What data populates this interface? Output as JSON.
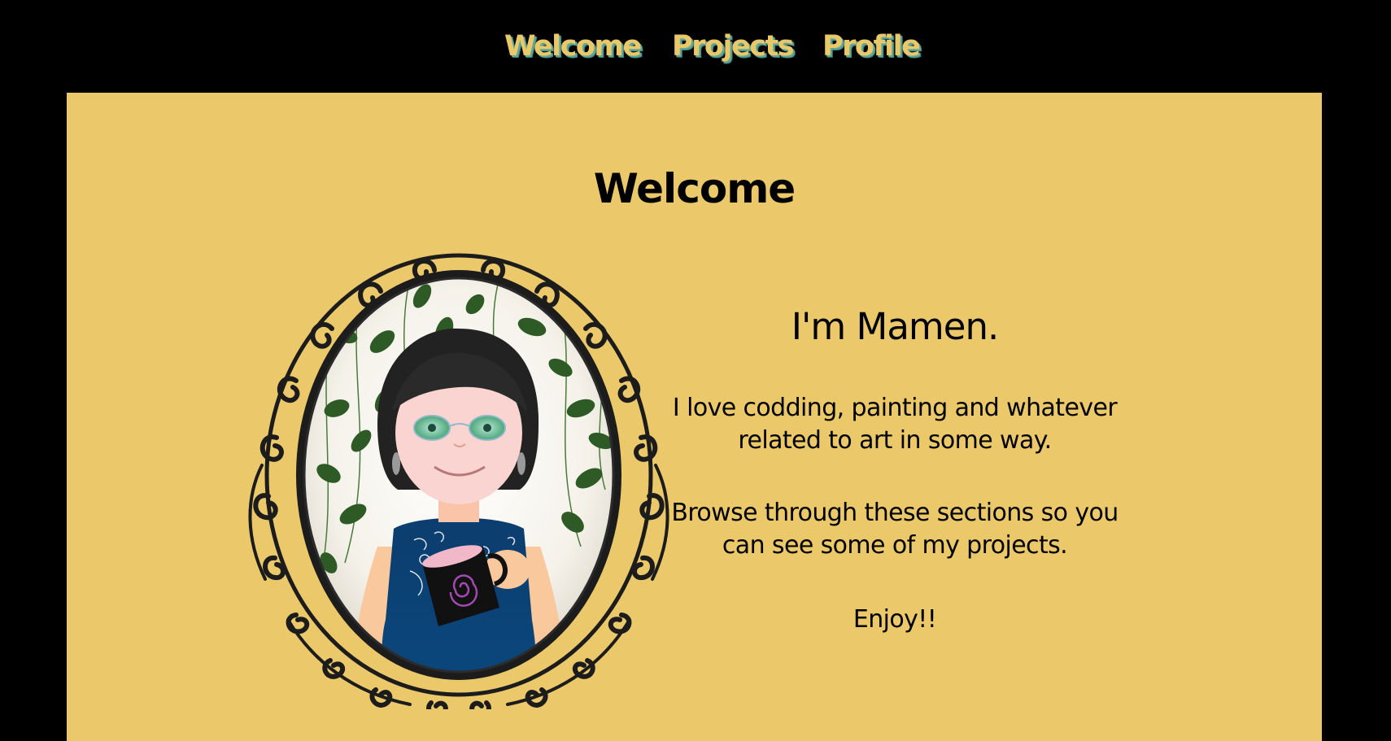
{
  "nav": {
    "items": [
      {
        "label": "Welcome"
      },
      {
        "label": "Projects"
      },
      {
        "label": "Profile"
      }
    ]
  },
  "main": {
    "title": "Welcome",
    "intro": {
      "heading": "I'm Mamen.",
      "paragraphs": [
        "I love codding, painting and whatever related to art in some way.",
        "Browse through these sections so you can see some of my projects.",
        "Enjoy!!"
      ]
    }
  },
  "colors": {
    "page_background": "#000000",
    "panel_background": "#ebc86a",
    "nav_text": "#e9c86a",
    "nav_shadow": "#5fa79a",
    "frame": "#1c1c1c",
    "dress": "#0c3d6e",
    "leaves": "#2e5a25"
  },
  "illustration": {
    "subject": "avatar-portrait",
    "icons": [
      "ornate-oval-frame",
      "ivy-leaves",
      "woman-with-glasses",
      "coffee-mug",
      "spiral"
    ]
  }
}
